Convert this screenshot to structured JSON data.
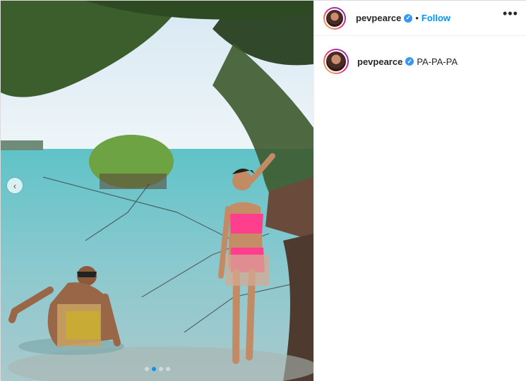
{
  "post": {
    "username": "pevpearce",
    "follow_label": "Follow",
    "separator": "•",
    "more_label": "•••",
    "caption": "PA-PA-PA",
    "verified_glyph": "✓",
    "carousel_prev_glyph": "‹"
  },
  "icons": {
    "verified": "verified-badge-icon",
    "more": "more-options-icon",
    "carousel_prev": "chevron-left-icon"
  },
  "colors": {
    "follow": "#0095f6",
    "verified": "#3897f0",
    "text": "#262626"
  },
  "carousel": {
    "slides": 4,
    "active_index": 1
  }
}
